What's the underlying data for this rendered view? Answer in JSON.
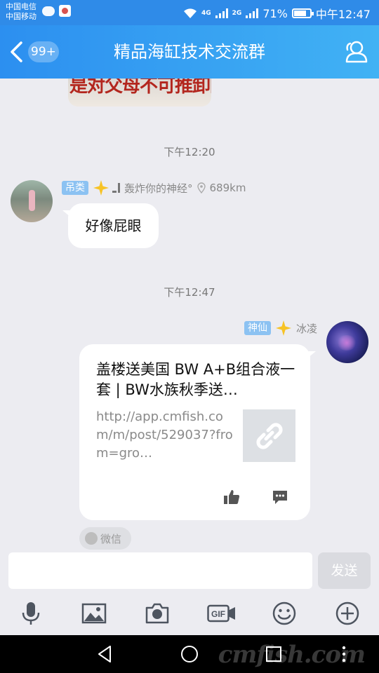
{
  "status_bar": {
    "carrier1": "中国电信",
    "carrier2": "中国移动",
    "network1": "4G",
    "network2": "2G",
    "battery": "71%",
    "time": "中午12:47"
  },
  "header": {
    "unread_badge": "99+",
    "title": "精品海缸技术交流群"
  },
  "chat": {
    "prev_image_text": "是对父母不可推卸的责任",
    "messages": [
      {
        "timestamp": "下午12:20",
        "sender_tag": "吊类",
        "sender_level": "_▌",
        "sender_name": "轰炸你的神经°",
        "distance": "689km",
        "text": "好像屁眼"
      },
      {
        "timestamp": "下午12:47",
        "sender_tag": "神仙",
        "sender_name": "冰凌",
        "card_title": "盖楼送美国 BW A+B组合液一套 | BW水族秋季送…",
        "card_url": "http://app.cmfish.com/m/post/529037?from=gro…",
        "source": "微信"
      }
    ]
  },
  "input": {
    "placeholder": "",
    "send_label": "发送"
  },
  "toolbar": [
    "mic-icon",
    "image-icon",
    "camera-icon",
    "gif-icon",
    "emoji-icon",
    "plus-icon"
  ],
  "watermark": "cmfish.com",
  "colors": {
    "header_start": "#2c8ff0",
    "header_end": "#41b2f4",
    "tag_blue": "#8cc2f2",
    "chat_bg": "#ececf1"
  }
}
